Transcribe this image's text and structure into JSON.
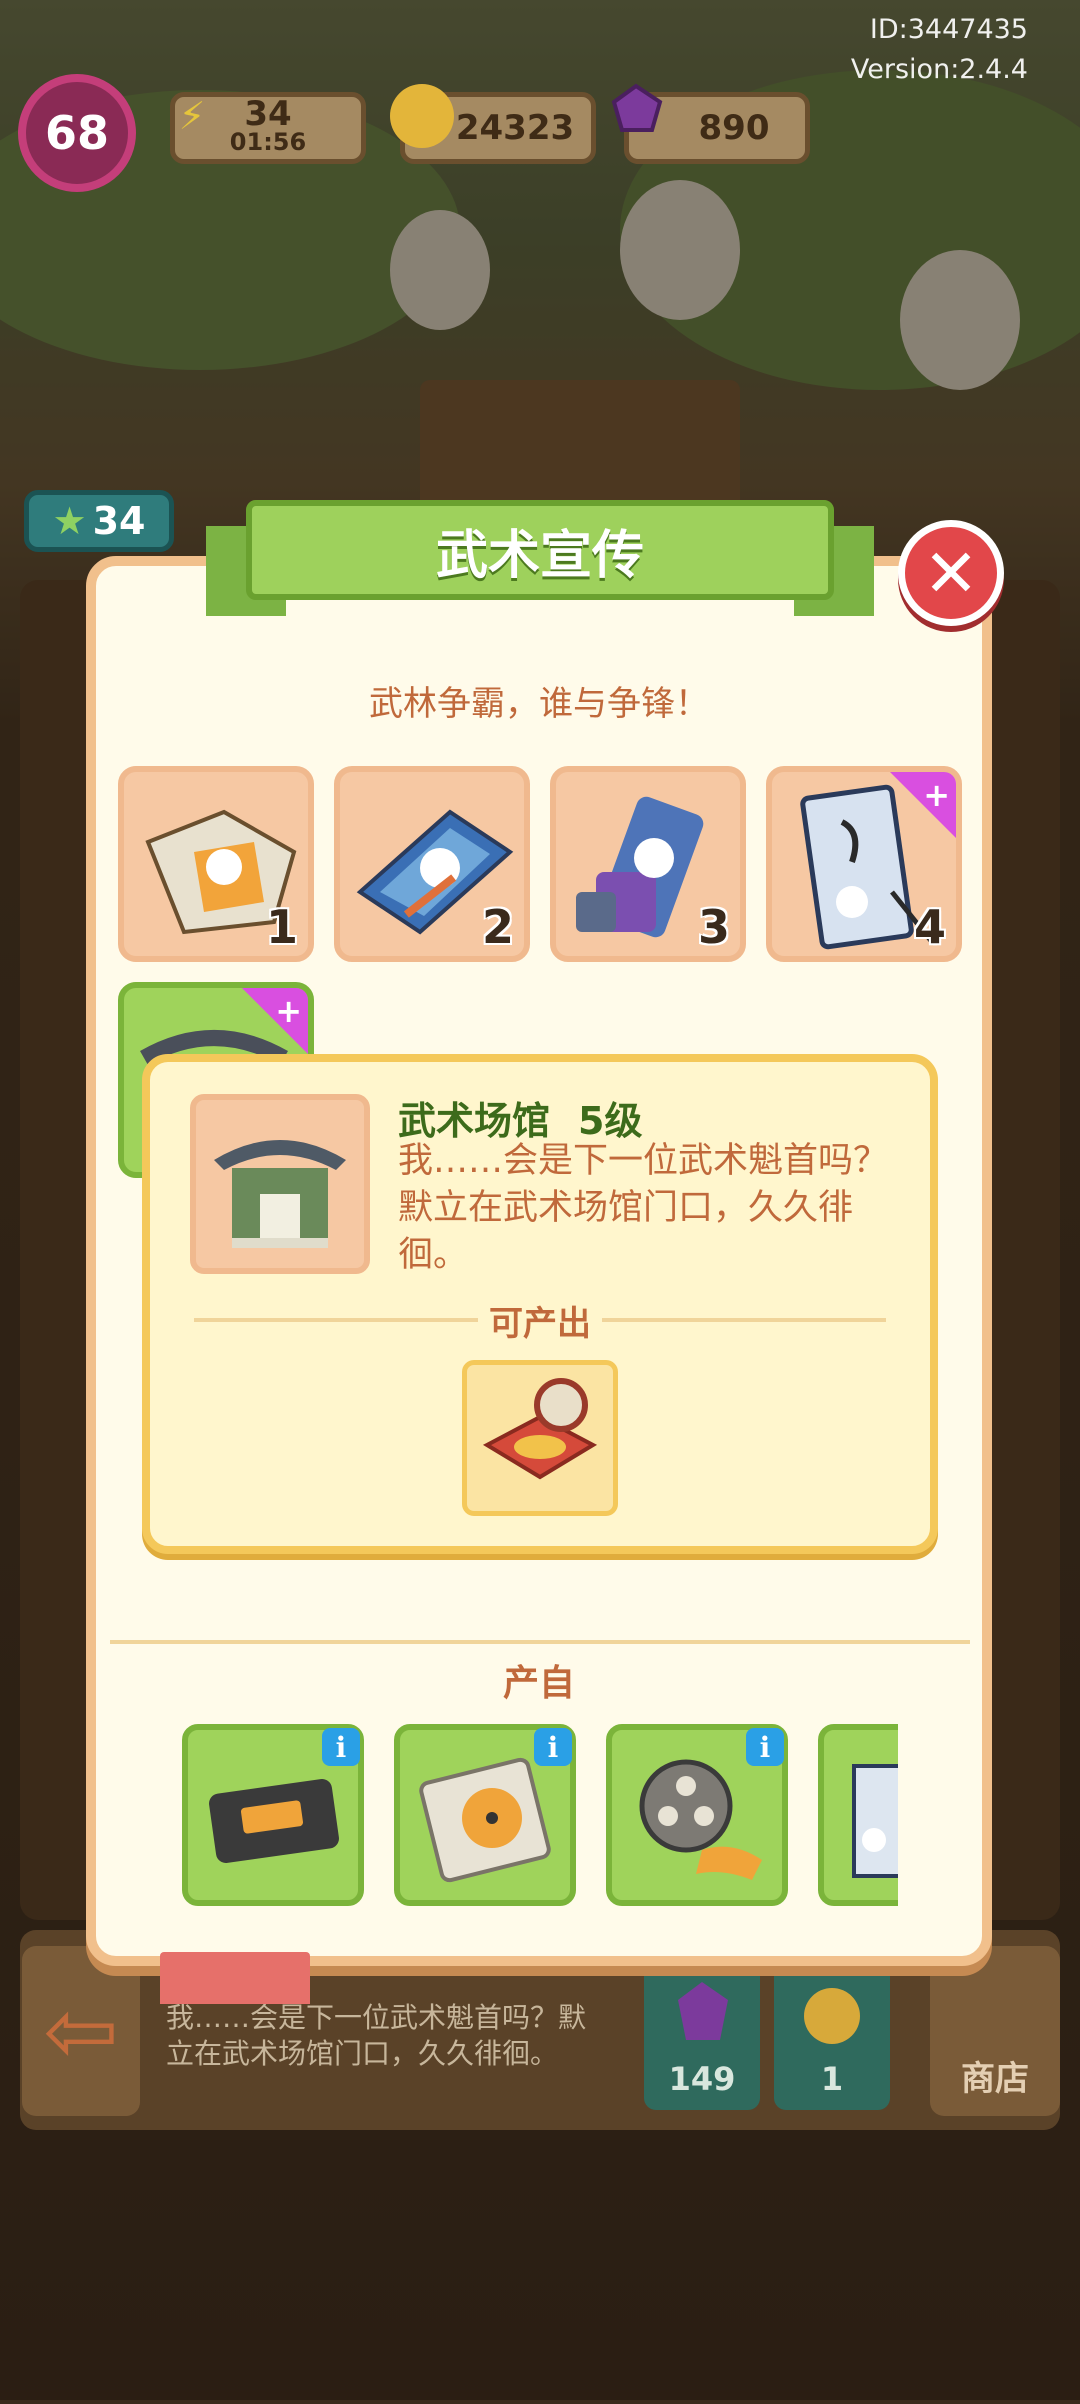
{
  "header": {
    "player_id": "ID:3447435",
    "version": "Version:2.4.4",
    "level": "68",
    "energy": {
      "value": "34",
      "timer": "01:56"
    },
    "coins": "24323",
    "gems": "890"
  },
  "background": {
    "mascot_stars": "34",
    "bottom_desc": "我……会是下一位武术魁首吗？默立在武术场馆门口，久久徘徊。",
    "gem_cost": "149",
    "coin_cost": "1",
    "shop_label": "商店"
  },
  "modal": {
    "title": "武术宣传",
    "close_symbol": "✕",
    "slogan": "武林争霸，谁与争锋！",
    "items": [
      {
        "num": "1",
        "icon": "poster-icon"
      },
      {
        "num": "2",
        "icon": "magazine-icon"
      },
      {
        "num": "3",
        "icon": "scroll-icon"
      },
      {
        "num": "4",
        "icon": "banner-stand-icon"
      }
    ],
    "detail": {
      "name": "武术场馆",
      "level": "5级",
      "desc": "我……会是下一位武术魁首吗？默立在武术场馆门口，久久徘徊。",
      "produce_label": "可产出"
    },
    "from_label": "产自",
    "sources": [
      {
        "icon": "videotape-icon"
      },
      {
        "icon": "cd-player-icon"
      },
      {
        "icon": "film-reel-icon"
      },
      {
        "icon": "poster-partial-icon"
      }
    ]
  },
  "colors": {
    "accent_green": "#9ed15c",
    "close_red": "#e2474a",
    "text_orange": "#c0693b",
    "title_green": "#3d6b1b"
  }
}
